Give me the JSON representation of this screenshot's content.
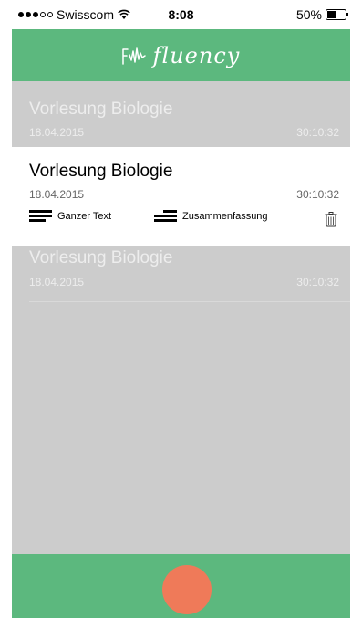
{
  "status_bar": {
    "carrier": "Swisscom",
    "time": "8:08",
    "battery": "50%",
    "signal_filled": 3,
    "signal_total": 5
  },
  "header": {
    "app_name": "fluency",
    "logo_icon": "waveform-icon",
    "background_color": "#5cb87e"
  },
  "recordings": [
    {
      "title": "Vorlesung Biologie",
      "date": "18.04.2015",
      "duration": "30:10:32",
      "state": "inactive"
    },
    {
      "title": "Vorlesung Biologie",
      "date": "18.04.2015",
      "duration": "30:10:32",
      "state": "active"
    },
    {
      "title": "Vorlesung Biologie",
      "date": "18.04.2015",
      "duration": "30:10:32",
      "state": "inactive"
    }
  ],
  "actions": {
    "full_text_label": "Ganzer Text",
    "summary_label": "Zusammenfassung",
    "delete_icon": "trash-icon"
  },
  "bottom_bar": {
    "record_button_color": "#ef7a59",
    "background_color": "#5cb87e"
  }
}
